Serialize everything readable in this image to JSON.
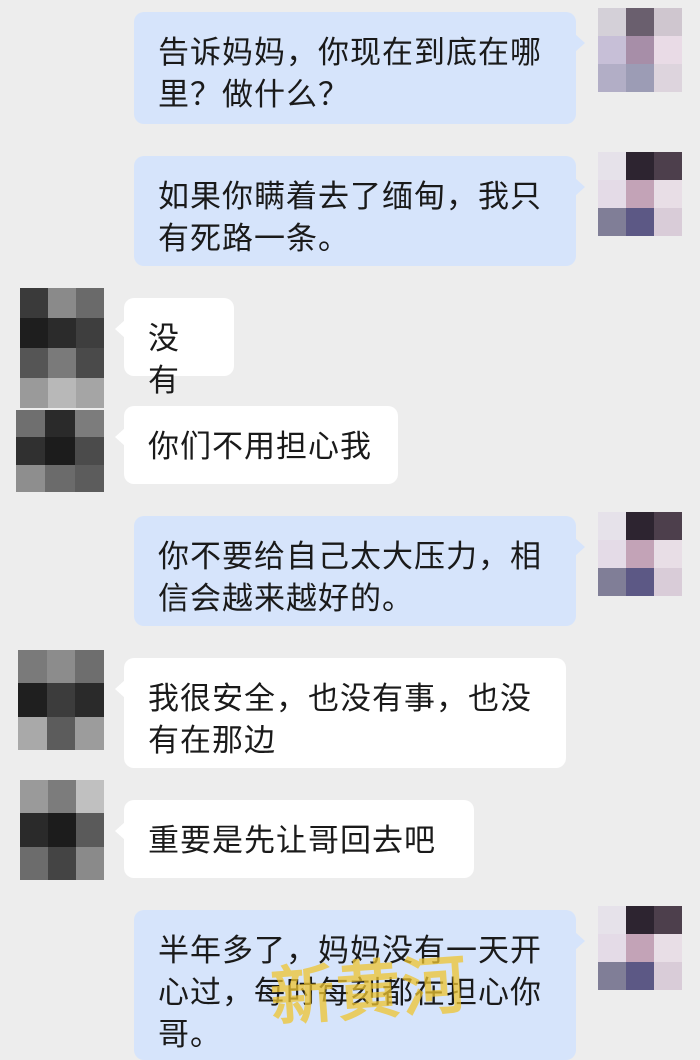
{
  "messages": [
    {
      "side": "out",
      "text": "告诉妈妈，你现在到底在哪里？做什么？"
    },
    {
      "side": "out",
      "text": "如果你瞒着去了缅甸，我只有死路一条。"
    },
    {
      "side": "in",
      "text": "没有"
    },
    {
      "side": "in",
      "text": "你们不用担心我"
    },
    {
      "side": "out",
      "text": "你不要给自己太大压力，相信会越来越好的。"
    },
    {
      "side": "in",
      "text": "我很安全，也没有事，也没有在那边"
    },
    {
      "side": "in",
      "text": "重要是先让哥回去吧"
    },
    {
      "side": "out",
      "text": "半年多了，妈妈没有一天开心过，每时每刻都在担心你哥。"
    }
  ],
  "watermark": "新黄河",
  "colors": {
    "background": "#ededed",
    "outgoing_bubble": "#d6e4fb",
    "incoming_bubble": "#ffffff"
  }
}
